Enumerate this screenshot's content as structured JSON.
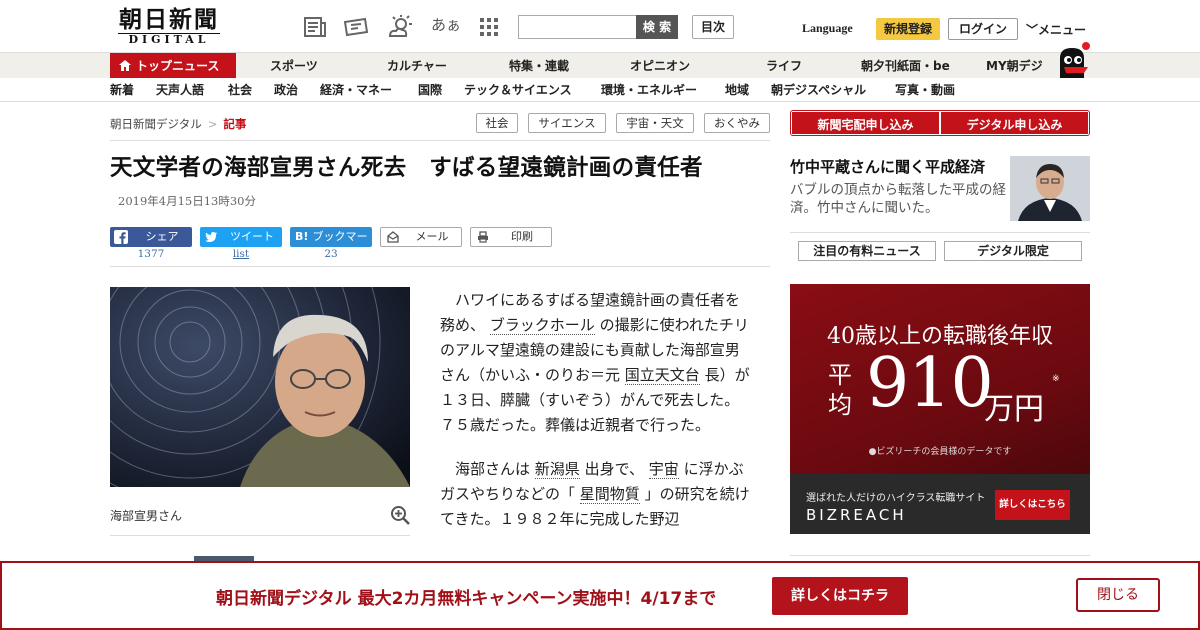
{
  "header": {
    "logo_line1": "朝日新聞",
    "logo_line2": "DIGITAL",
    "font_size_label": "あぁ",
    "search_placeholder": "",
    "search_button": "検 索",
    "contents_button": "目次",
    "language": "Language",
    "register": "新規登録",
    "login": "ログイン",
    "menu": "メニュー"
  },
  "nav_primary": [
    "トップニュース",
    "スポーツ",
    "カルチャー",
    "特集・連載",
    "オピニオン",
    "ライフ",
    "朝夕刊紙面・be",
    "MY朝デジ"
  ],
  "nav_secondary": [
    "新着",
    "天声人語",
    "社会",
    "政治",
    "経済・マネー",
    "国際",
    "テック＆サイエンス",
    "環境・エネルギー",
    "地域",
    "朝デジスペシャル",
    "写真・動画"
  ],
  "breadcrumb": {
    "home": "朝日新聞デジタル",
    "sep": ">",
    "current": "記事"
  },
  "tags": [
    "社会",
    "サイエンス",
    "宇宙・天文",
    "おくやみ"
  ],
  "article": {
    "title": "天文学者の海部宣男さん死去　すばる望遠鏡計画の責任者",
    "date": "2019年4月15日13時30分",
    "share": [
      {
        "label": "シェア",
        "count": "1377"
      },
      {
        "label": "ツイート",
        "count": "list"
      },
      {
        "label": "ブックマーク",
        "count": "23"
      },
      {
        "label": "メール",
        "count": ""
      },
      {
        "label": "印刷",
        "count": ""
      }
    ],
    "caption": "海部宣男さん",
    "p1": [
      {
        "t": "ハワイにあるすばる望遠鏡計画の責任者を務め、",
        "link": false
      },
      {
        "t": "ブラックホール",
        "link": true
      },
      {
        "t": "の撮影に使われたチリのアルマ望遠鏡の建設にも貢献した海部宣男さん（かいふ・のりお＝元",
        "link": false
      },
      {
        "t": "国立天文台",
        "link": true
      },
      {
        "t": "長）が１３日、膵臓（すいぞう）がんで死去した。７５歳だった。葬儀は近親者で行った。",
        "link": false
      }
    ],
    "p2": [
      {
        "t": "海部さんは",
        "link": false
      },
      {
        "t": "新潟県",
        "link": true
      },
      {
        "t": "出身で、",
        "link": false
      },
      {
        "t": "宇宙",
        "link": true
      },
      {
        "t": "に浮かぶガスやちりなどの「",
        "link": false
      },
      {
        "t": "星間物質",
        "link": true
      },
      {
        "t": "」の研究を続けてきた。１９８２年に完成した野辺",
        "link": false
      }
    ]
  },
  "sidebar": {
    "btn_delivery": "新聞宅配申し込み",
    "btn_digital": "デジタル申し込み",
    "feature_title": "竹中平蔵さんに聞く平成経済",
    "feature_text": "バブルの頂点から転落した平成の経済。竹中さんに聞いた。",
    "tab_paid": "注目の有料ニュース",
    "tab_digital": "デジタル限定"
  },
  "ad": {
    "headline": "40歳以上の転職後年収",
    "avg_label": "平均",
    "amount": "910",
    "unit": "万円",
    "asterisk": "※",
    "note": "●ビズリーチの会員様のデータです",
    "tagline": "選ばれた人だけのハイクラス転職サイト",
    "brand": "BIZREACH",
    "cta": "詳しくはこちら"
  },
  "banner": {
    "text": "朝日新聞デジタル 最大2カ月無料キャンペーン実施中！4/17まで",
    "button": "詳しくはコチラ",
    "close": "閉じる"
  },
  "colors": {
    "accent": "#c4121b",
    "nav_bg": "#f1efe9",
    "facebook": "#3b5998",
    "twitter": "#1da1f2",
    "hatena": "#2c8ed6"
  }
}
